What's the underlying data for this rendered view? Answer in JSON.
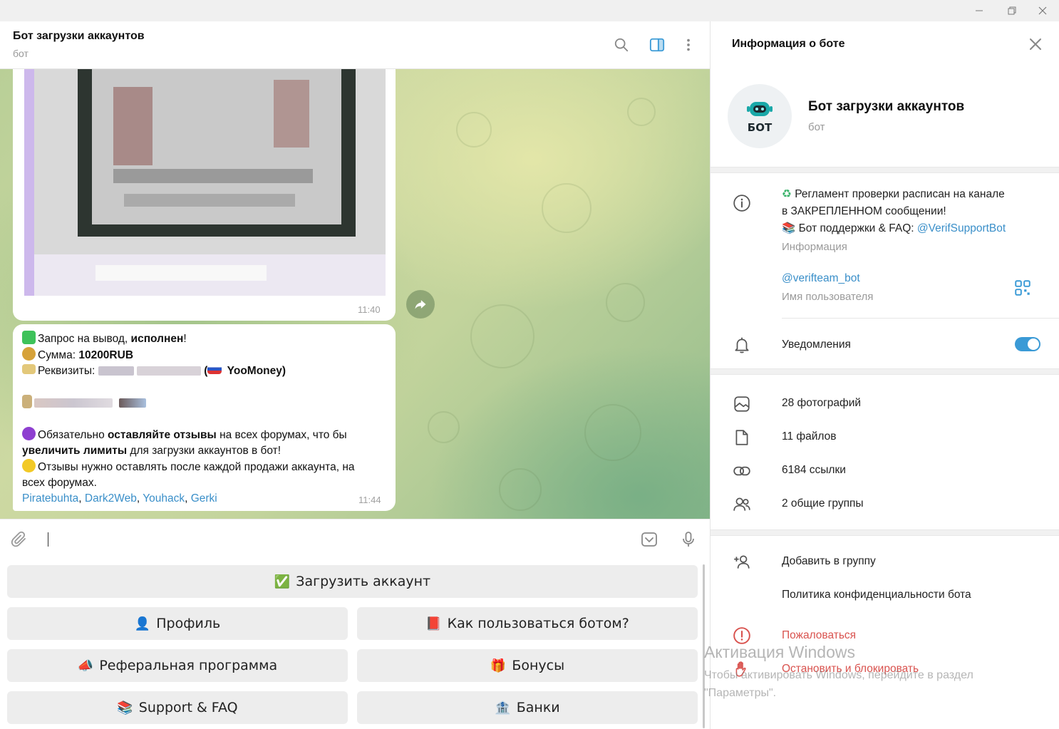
{
  "window": {
    "controls": [
      "minimize-icon",
      "restore-icon",
      "close-icon"
    ]
  },
  "chat": {
    "title": "Бот загрузки аккаунтов",
    "subtitle": "бот",
    "header_icons": [
      "search-icon",
      "sidebar-toggle-icon",
      "more-vertical-icon"
    ]
  },
  "messages": {
    "photo_time": "11:40",
    "text_time": "11:44",
    "lines": {
      "l1_a": "Запрос на вывод, ",
      "l1_b": "исполнен",
      "l1_c": "!",
      "l2_a": "Сумма: ",
      "l2_b": "10200RUB",
      "l3_a": "Реквизиты: ",
      "l3_b": " (",
      "l3_c": " YooMoney)",
      "l5_a": "Обязательно ",
      "l5_b": "оставляйте отзывы",
      "l5_c": " на всех форумах, что бы",
      "l6_a": "увеличить лимиты",
      "l6_b": " для загрузки аккаунтов в бот!",
      "l7": "Отзывы нужно оставлять после каждой продажи аккаунта, на",
      "l8": "всех форумах."
    },
    "links": [
      "Piratebuhta",
      "Dark2Web",
      "Youhack",
      "Gerki"
    ],
    "links_sep": ", "
  },
  "composer": {
    "placeholder": ""
  },
  "keyboard": {
    "buttons": [
      {
        "icon": "✅",
        "label": "Загрузить аккаунт"
      },
      {
        "icon": "👤",
        "label": "Профиль"
      },
      {
        "icon": "📕",
        "label": "Как пользоваться ботом?"
      },
      {
        "icon": "📣",
        "label": "Реферальная программа"
      },
      {
        "icon": "🎁",
        "label": "Бонусы"
      },
      {
        "icon": "📚",
        "label": "Support & FAQ"
      },
      {
        "icon": "🏦",
        "label": "Банки"
      }
    ]
  },
  "panel": {
    "title": "Информация о боте",
    "avatar_text": "БОТ",
    "name": "Бот загрузки аккаунтов",
    "name_sub": "бот",
    "info_line1": "Регламент проверки расписан на канале",
    "info_line2": "в ЗАКРЕПЛЕННОМ сообщении!",
    "info_line3_a": "Бот поддержки & FAQ: ",
    "info_line3_link": "@VerifSupportBot",
    "info_label": "Информация",
    "username": "@verifteam_bot",
    "username_label": "Имя пользователя",
    "notifications": "Уведомления",
    "notifications_on": true,
    "media": {
      "photos": "28 фотографий",
      "files": "11 файлов",
      "links": "6184 ссылки",
      "groups": "2 общие группы"
    },
    "add_to_group": "Добавить в группу",
    "privacy": "Политика конфиденциальности бота",
    "report": "Пожаловаться",
    "block": "Остановить и блокировать"
  },
  "watermark": {
    "title": "Активация Windows",
    "line1": "Чтобы активировать Windows, перейдите в раздел",
    "line2": "\"Параметры\"."
  }
}
